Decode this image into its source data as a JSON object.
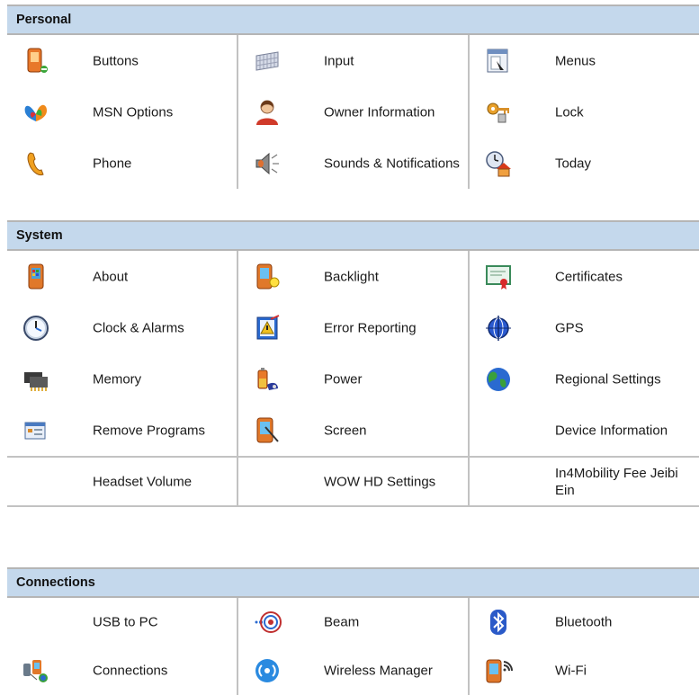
{
  "sections": [
    {
      "title": "Personal",
      "items": [
        {
          "label": "Buttons",
          "icon": "pda-buttons-icon"
        },
        {
          "label": "Input",
          "icon": "keyboard-icon"
        },
        {
          "label": "Menus",
          "icon": "menu-window-icon"
        },
        {
          "label": "MSN Options",
          "icon": "msn-butterfly-icon"
        },
        {
          "label": "Owner Information",
          "icon": "owner-person-icon"
        },
        {
          "label": "Lock",
          "icon": "keys-lock-icon"
        },
        {
          "label": "Phone",
          "icon": "phone-handset-icon"
        },
        {
          "label": "Sounds & Notifications",
          "icon": "speaker-icon"
        },
        {
          "label": "Today",
          "icon": "today-clock-house-icon"
        }
      ]
    },
    {
      "title": "System",
      "items": [
        {
          "label": "About",
          "icon": "pda-about-icon"
        },
        {
          "label": "Backlight",
          "icon": "pda-backlight-icon"
        },
        {
          "label": "Certificates",
          "icon": "certificate-icon"
        },
        {
          "label": "Clock & Alarms",
          "icon": "clock-icon"
        },
        {
          "label": "Error Reporting",
          "icon": "error-report-icon"
        },
        {
          "label": "GPS",
          "icon": "gps-globe-icon"
        },
        {
          "label": "Memory",
          "icon": "memory-chip-icon"
        },
        {
          "label": "Power",
          "icon": "battery-power-icon"
        },
        {
          "label": "Regional Settings",
          "icon": "earth-globe-icon"
        },
        {
          "label": "Remove Programs",
          "icon": "remove-programs-icon"
        },
        {
          "label": "Screen",
          "icon": "pda-screen-icon"
        },
        {
          "label": "Device Information",
          "icon": ""
        },
        {
          "label": "Headset Volume",
          "icon": ""
        },
        {
          "label": "WOW HD Settings",
          "icon": ""
        },
        {
          "label": "In4Mobility Fee Jeibi Ein",
          "icon": ""
        }
      ]
    },
    {
      "title": "Connections",
      "items": [
        {
          "label": "USB to PC",
          "icon": ""
        },
        {
          "label": "Beam",
          "icon": "beam-infrared-icon"
        },
        {
          "label": "Bluetooth",
          "icon": "bluetooth-icon"
        },
        {
          "label": "Connections",
          "icon": "network-connections-icon"
        },
        {
          "label": "Wireless Manager",
          "icon": "wireless-manager-icon"
        },
        {
          "label": "Wi-Fi",
          "icon": "pda-wifi-icon"
        }
      ]
    }
  ],
  "colors": {
    "header_bg": "#c4d8ec",
    "grid_line": "#c2c2c2"
  }
}
